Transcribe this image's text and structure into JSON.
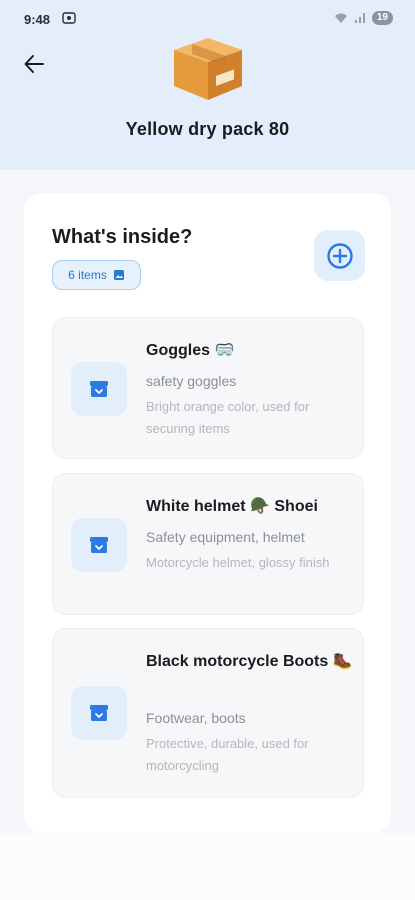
{
  "status_bar": {
    "time": "9:48",
    "battery": "19"
  },
  "header": {
    "title": "Yellow dry pack 80"
  },
  "section": {
    "title": "What's inside?",
    "count_label": "6 items"
  },
  "items": [
    {
      "name": "Goggles 🥽",
      "category": "safety goggles",
      "description": "Bright orange color, used for securing items"
    },
    {
      "name": "White helmet 🪖 Shoei",
      "category": "Safety equipment, helmet",
      "description": "Motorcycle helmet, glossy finish"
    },
    {
      "name": "Black motorcycle Boots 🥾",
      "category": "Footwear, boots",
      "description": "Protective, durable, used for motorcycling"
    }
  ],
  "icons": {
    "back": "arrow-left-icon",
    "add": "plus-circle-icon",
    "count": "image-icon",
    "item": "archive-box-icon",
    "header": "package-box-icon"
  },
  "colors": {
    "accent": "#2c7be5",
    "header_bg": "#e4eefa",
    "chip_bg": "#e6f1fc"
  }
}
